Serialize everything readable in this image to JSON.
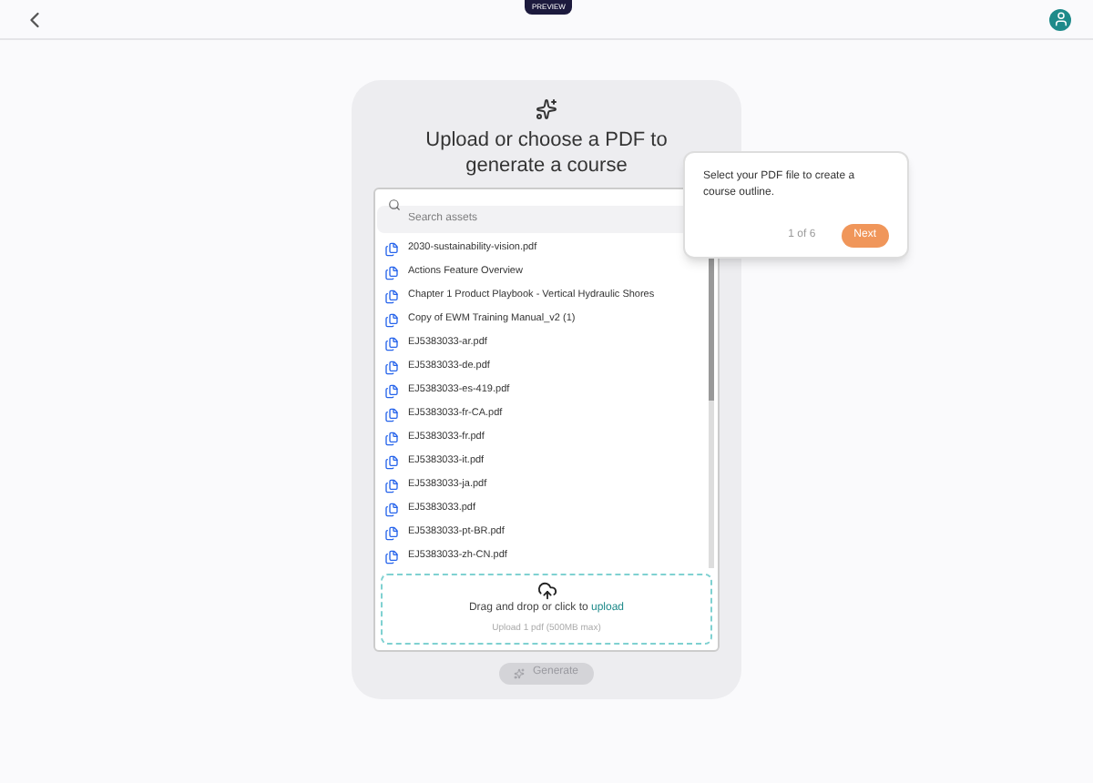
{
  "header": {
    "badge": "PREVIEW"
  },
  "card": {
    "title": "Upload or choose a PDF to generate a course",
    "search": {
      "placeholder": "Search assets"
    },
    "assets": [
      {
        "name": "2030-sustainability-vision.pdf"
      },
      {
        "name": "Actions Feature Overview"
      },
      {
        "name": "Chapter 1 Product Playbook - Vertical Hydraulic Shores"
      },
      {
        "name": "Copy of EWM Training Manual_v2 (1)"
      },
      {
        "name": "EJ5383033-ar.pdf"
      },
      {
        "name": "EJ5383033-de.pdf"
      },
      {
        "name": "EJ5383033-es-419.pdf"
      },
      {
        "name": "EJ5383033-fr-CA.pdf"
      },
      {
        "name": "EJ5383033-fr.pdf"
      },
      {
        "name": "EJ5383033-it.pdf"
      },
      {
        "name": "EJ5383033-ja.pdf"
      },
      {
        "name": "EJ5383033.pdf"
      },
      {
        "name": "EJ5383033-pt-BR.pdf"
      },
      {
        "name": "EJ5383033-zh-CN.pdf"
      }
    ],
    "dropzone": {
      "text": "Drag and drop or click to",
      "link": "upload",
      "hint": "Upload 1 pdf (500MB max)"
    },
    "generate": {
      "label": "Generate",
      "disabled": true
    }
  },
  "tour": {
    "text": "Select your PDF file to create a course outline.",
    "step": "1 of 6",
    "next": "Next"
  }
}
